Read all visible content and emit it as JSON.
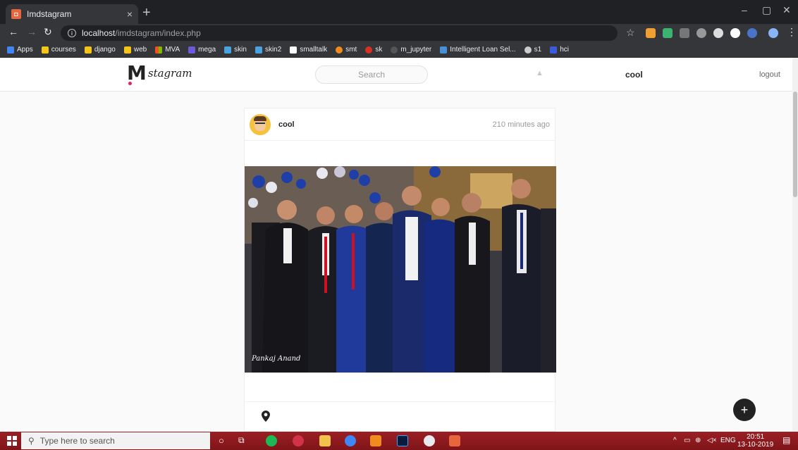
{
  "browser": {
    "tab_title": "Imdstagram",
    "tab_close": "×",
    "new_tab": "+",
    "url_host": "localhost",
    "url_path": "/imdstagram/index.php",
    "bookmarks": [
      "Apps",
      "courses",
      "django",
      "web",
      "MVA",
      "mega",
      "skin",
      "skin2",
      "smalltalk",
      "smt",
      "sk",
      "m_jupyter",
      "Intelligent Loan Sel...",
      "s1",
      "hci"
    ]
  },
  "header": {
    "logo_text": "stagram",
    "search_placeholder": "Search",
    "username": "cool",
    "logout_label": "logout"
  },
  "post": {
    "user": "cool",
    "time": "210 minutes ago",
    "photo_watermark": "Pankaj Anand"
  },
  "fab_label": "+",
  "taskbar": {
    "search_placeholder": "Type here to search",
    "lang": "ENG",
    "time": "20:51",
    "date": "13-10-2019"
  },
  "colors": {
    "taskbar": "#8b1a1a",
    "chrome_dark": "#202124",
    "chrome_toolbar": "#35363a"
  }
}
